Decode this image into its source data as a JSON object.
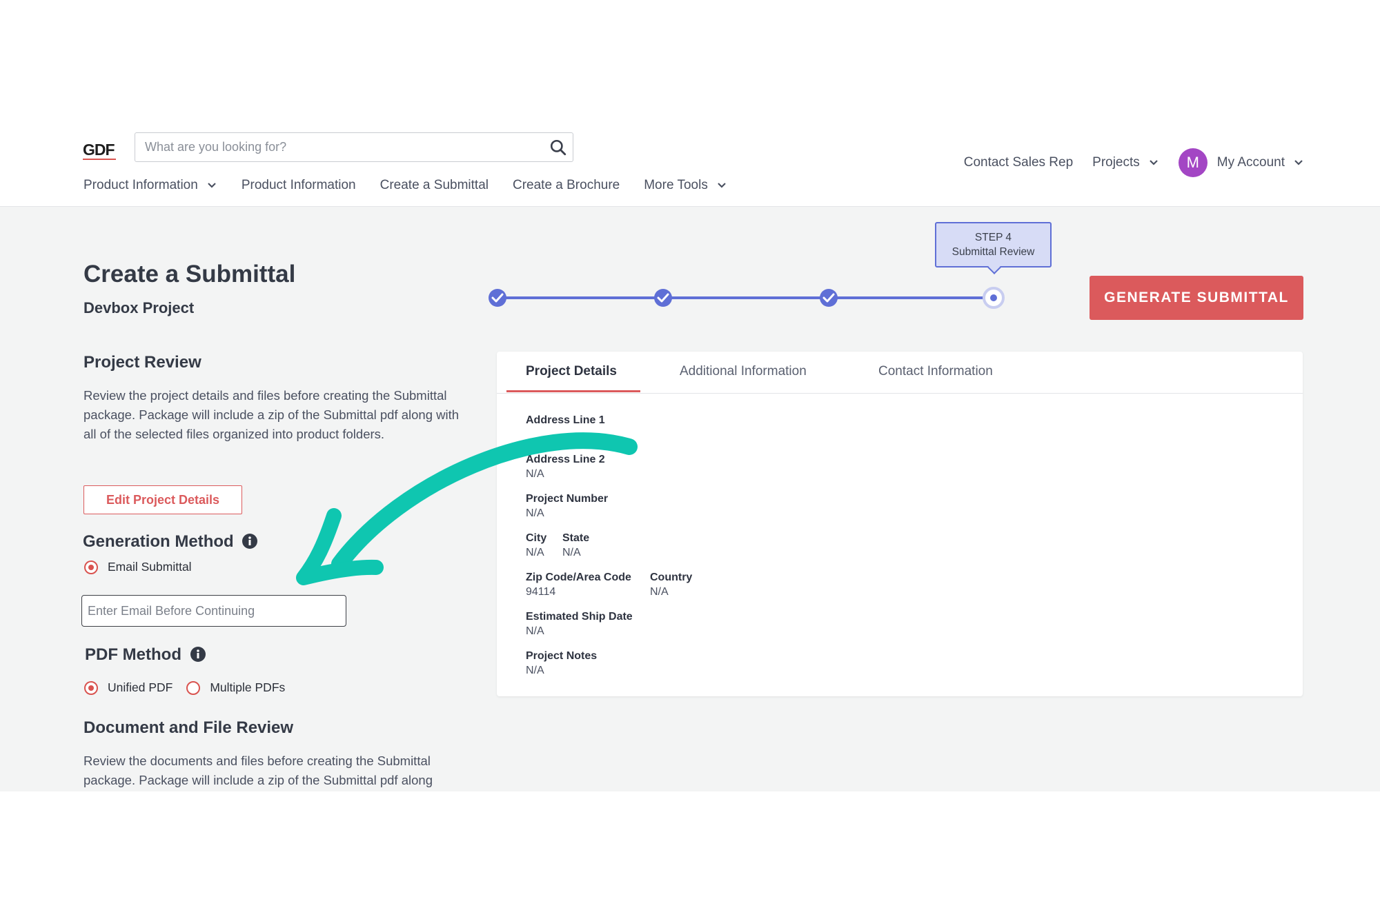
{
  "header": {
    "logo_text": "GDF",
    "search_placeholder": "What are you looking for?",
    "nav": [
      {
        "label": "Product Information",
        "has_dropdown": true
      },
      {
        "label": "Product Information",
        "has_dropdown": false
      },
      {
        "label": "Create a Submittal",
        "has_dropdown": false
      },
      {
        "label": "Create a Brochure",
        "has_dropdown": false
      },
      {
        "label": "More Tools",
        "has_dropdown": true
      }
    ],
    "right": {
      "contact": "Contact Sales Rep",
      "projects": "Projects",
      "avatar_initial": "M",
      "account": "My Account"
    }
  },
  "page": {
    "title": "Create a Submittal",
    "project_name": "Devbox Project",
    "generate_button": "GENERATE SUBMITTAL"
  },
  "stepper": {
    "current_step": 4,
    "total_steps": 4,
    "tooltip_step": "STEP 4",
    "tooltip_label": "Submittal Review"
  },
  "review": {
    "heading": "Project Review",
    "description": "Review the project details and files before creating the Submittal package. Package will include a zip of the Submittal pdf along with all of the selected files organized into product folders.",
    "edit_button": "Edit Project Details"
  },
  "generation": {
    "heading": "Generation Method",
    "option_label": "Email Submittal",
    "email_placeholder": "Enter Email Before Continuing"
  },
  "pdf": {
    "heading": "PDF Method",
    "options": [
      {
        "label": "Unified PDF",
        "selected": true
      },
      {
        "label": "Multiple PDFs",
        "selected": false
      }
    ]
  },
  "docs": {
    "heading": "Document and File Review",
    "description": "Review the documents and files before creating the Submittal package. Package will include a zip of the Submittal pdf along"
  },
  "card": {
    "tabs": [
      "Project Details",
      "Additional Information",
      "Contact Information"
    ],
    "active_tab": 0,
    "fields": {
      "address1": {
        "label": "Address Line 1",
        "value": ""
      },
      "address2": {
        "label": "Address Line 2",
        "value": "N/A"
      },
      "project_number": {
        "label": "Project Number",
        "value": "N/A"
      },
      "city": {
        "label": "City",
        "value": "N/A"
      },
      "state": {
        "label": "State",
        "value": "N/A"
      },
      "zip": {
        "label": "Zip Code/Area Code",
        "value": "94114"
      },
      "country": {
        "label": "Country",
        "value": "N/A"
      },
      "ship_date": {
        "label": "Estimated Ship Date",
        "value": "N/A"
      },
      "notes": {
        "label": "Project Notes",
        "value": "N/A"
      }
    }
  },
  "colors": {
    "accent_red": "#db5a5c",
    "stepper_blue": "#5f6fd6",
    "avatar_purple": "#a346c4",
    "annotation_teal": "#0fc6b0"
  },
  "icons": [
    "search-icon",
    "chevron-down-icon",
    "info-icon",
    "check-icon",
    "annotation-arrow"
  ]
}
